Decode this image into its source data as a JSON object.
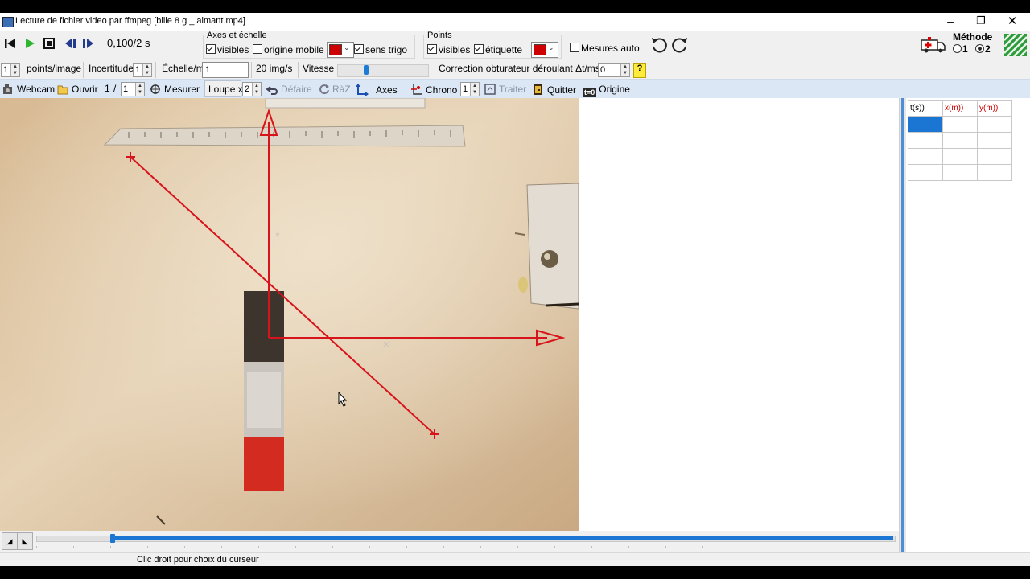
{
  "window": {
    "title": "Lecture de fichier video par ffmpeg [bille 8 g _ aimant.mp4]"
  },
  "toolbar1": {
    "time_display": "0,100/2 s",
    "axes_group_title": "Axes et échelle",
    "axes_visibles": "visibles",
    "origine_mobile": "origine mobile",
    "sens_trigo": "sens trigo",
    "points_group_title": "Points",
    "points_visibles": "visibles",
    "etiquette": "étiquette",
    "mesures_auto": "Mesures auto",
    "methode_label": "Méthode",
    "methode_opt1": "1",
    "methode_opt2": "2",
    "axes_color": "#cc0000",
    "points_color": "#cc0000"
  },
  "toolbar2": {
    "points_value": "1",
    "points_label": "points/image",
    "incertitude_label": "Incertitude",
    "incertitude_value": "1",
    "echelle_label": "Échelle/m",
    "echelle_value": "1",
    "fps": "20 img/s",
    "vitesse_label": "Vitesse",
    "vitesse_level": 0.3,
    "correction_label": "Correction obturateur déroulant Δt/ms=",
    "correction_value": "0",
    "help": "?"
  },
  "toolbar3": {
    "webcam": "Webcam",
    "ouvrir": "Ouvrir",
    "frame_current": "1",
    "frame_sep": "/",
    "frame_total": "1",
    "mesurer": "Mesurer",
    "loupe": "Loupe x",
    "loupe_value": "2",
    "defaire": "Défaire",
    "raz": "RàZ",
    "axes": "Axes",
    "chrono": "Chrono",
    "chrono_value": "1",
    "traiter": "Traiter",
    "quitter": "Quitter",
    "t0": "t=0",
    "origine": "Origine"
  },
  "table": {
    "headers": [
      "t(s))",
      "x(m))",
      "y(m))"
    ],
    "rows": 4
  },
  "status": {
    "text": "Clic droit pour choix du curseur"
  },
  "scrubber": {
    "position": 0.0
  }
}
